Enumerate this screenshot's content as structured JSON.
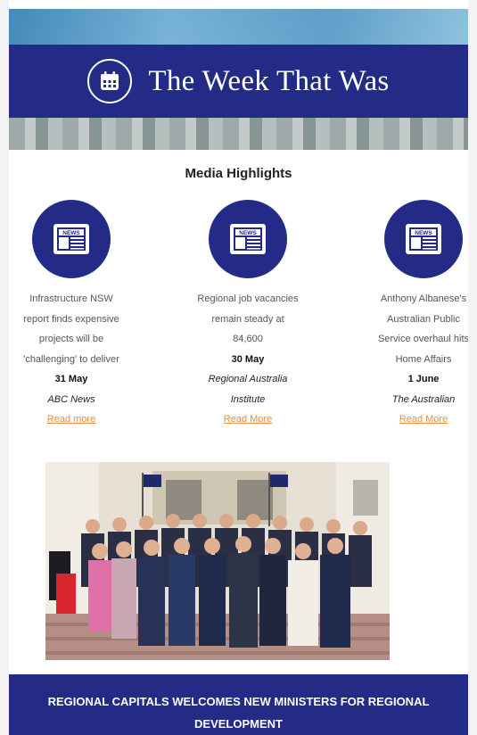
{
  "header": {
    "title": "The Week That Was",
    "icon": "calendar-icon"
  },
  "media": {
    "section_title": "Media Highlights",
    "items": [
      {
        "icon": "news-icon",
        "lines": [
          "Infrastructure NSW",
          "report finds expensive",
          "projects will be",
          "'challenging' to deliver"
        ],
        "date": "31 May",
        "source_lines": [
          "ABC News"
        ],
        "link": "Read more"
      },
      {
        "icon": "news-icon",
        "lines": [
          "Regional job vacancies",
          "remain steady at",
          "84,600"
        ],
        "date": "30 May",
        "source_lines": [
          "Regional Australia",
          "Institute"
        ],
        "link": "Read More"
      },
      {
        "icon": "news-icon",
        "lines": [
          "Anthony Albanese's",
          "Australian Public",
          "Service overhaul hits",
          "Home Affairs"
        ],
        "date": "1 June",
        "source_lines": [
          "The Australian"
        ],
        "link": "Read More"
      }
    ]
  },
  "photo": {
    "subject": "group-photo"
  },
  "footer": {
    "line1": "REGIONAL CAPITALS WELCOMES NEW MINISTERS FOR REGIONAL",
    "line2": "DEVELOPMENT"
  },
  "colors": {
    "brand_navy": "#232b86",
    "link_orange": "#f08a3a"
  }
}
